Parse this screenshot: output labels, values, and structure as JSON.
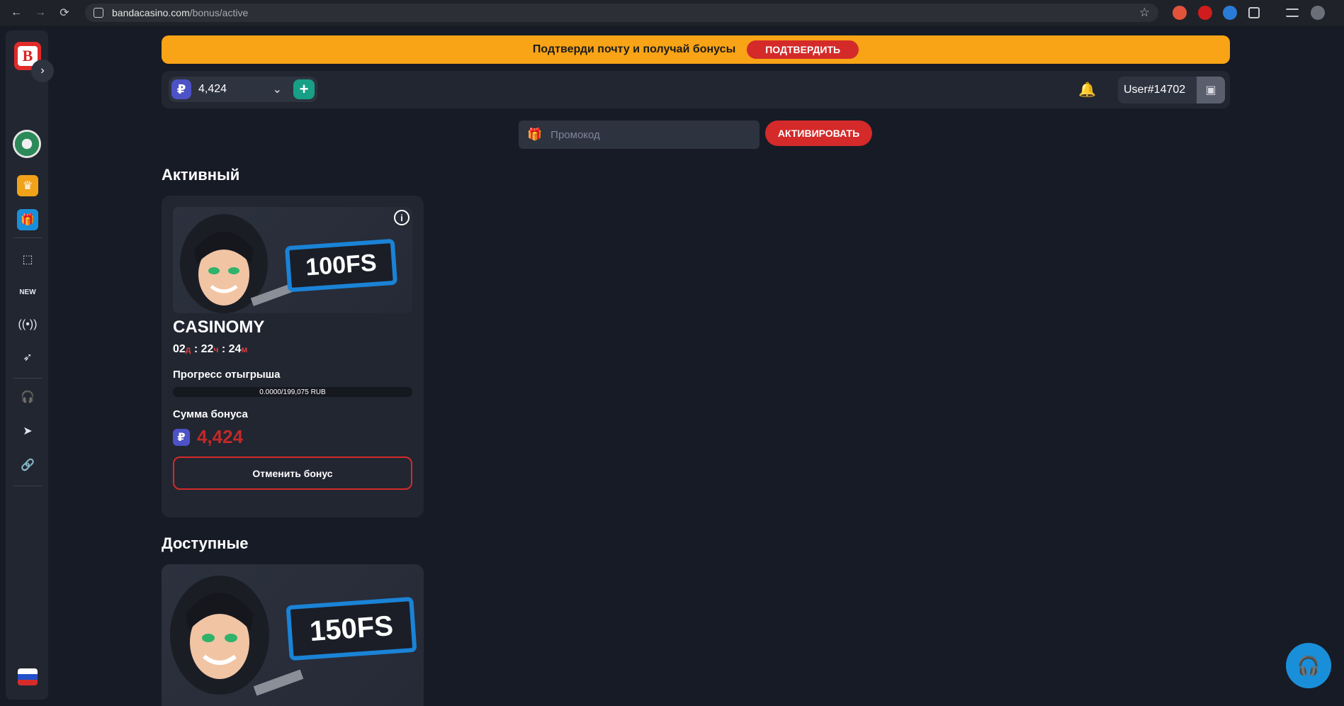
{
  "browser": {
    "url_host": "bandacasino.com",
    "url_path": "/bonus/active"
  },
  "banner": {
    "text": "Подтверди почту и получай бонусы",
    "button": "ПОДТВЕРДИТЬ"
  },
  "header": {
    "currency_symbol": "₽",
    "balance": "4,424",
    "username": "User#14702"
  },
  "promo": {
    "placeholder": "Промокод",
    "button": "АКТИВИРОВАТЬ"
  },
  "sections": {
    "active": "Активный",
    "available": "Доступные"
  },
  "active_bonus": {
    "badge": "100FS",
    "title": "CASINOMY",
    "timer": {
      "days": "02",
      "days_unit": "д",
      "hours": "22",
      "hours_unit": "ч",
      "minutes": "24",
      "minutes_unit": "м"
    },
    "progress_label": "Прогресс отыгрыша",
    "progress_text": "0.0000/199,075 RUB",
    "progress_fraction": 0,
    "amount_label": "Сумма бонуса",
    "currency_symbol": "₽",
    "amount": "4,424",
    "cancel_button": "Отменить бонус"
  },
  "available_bonus": {
    "badge": "150FS"
  },
  "sidebar": {
    "new_label": "NEW"
  },
  "colors": {
    "accent_red": "#d42a2a",
    "banner_orange": "#f9a416",
    "teal": "#17a086",
    "blue": "#1a83d6",
    "bg": "#171b26"
  }
}
